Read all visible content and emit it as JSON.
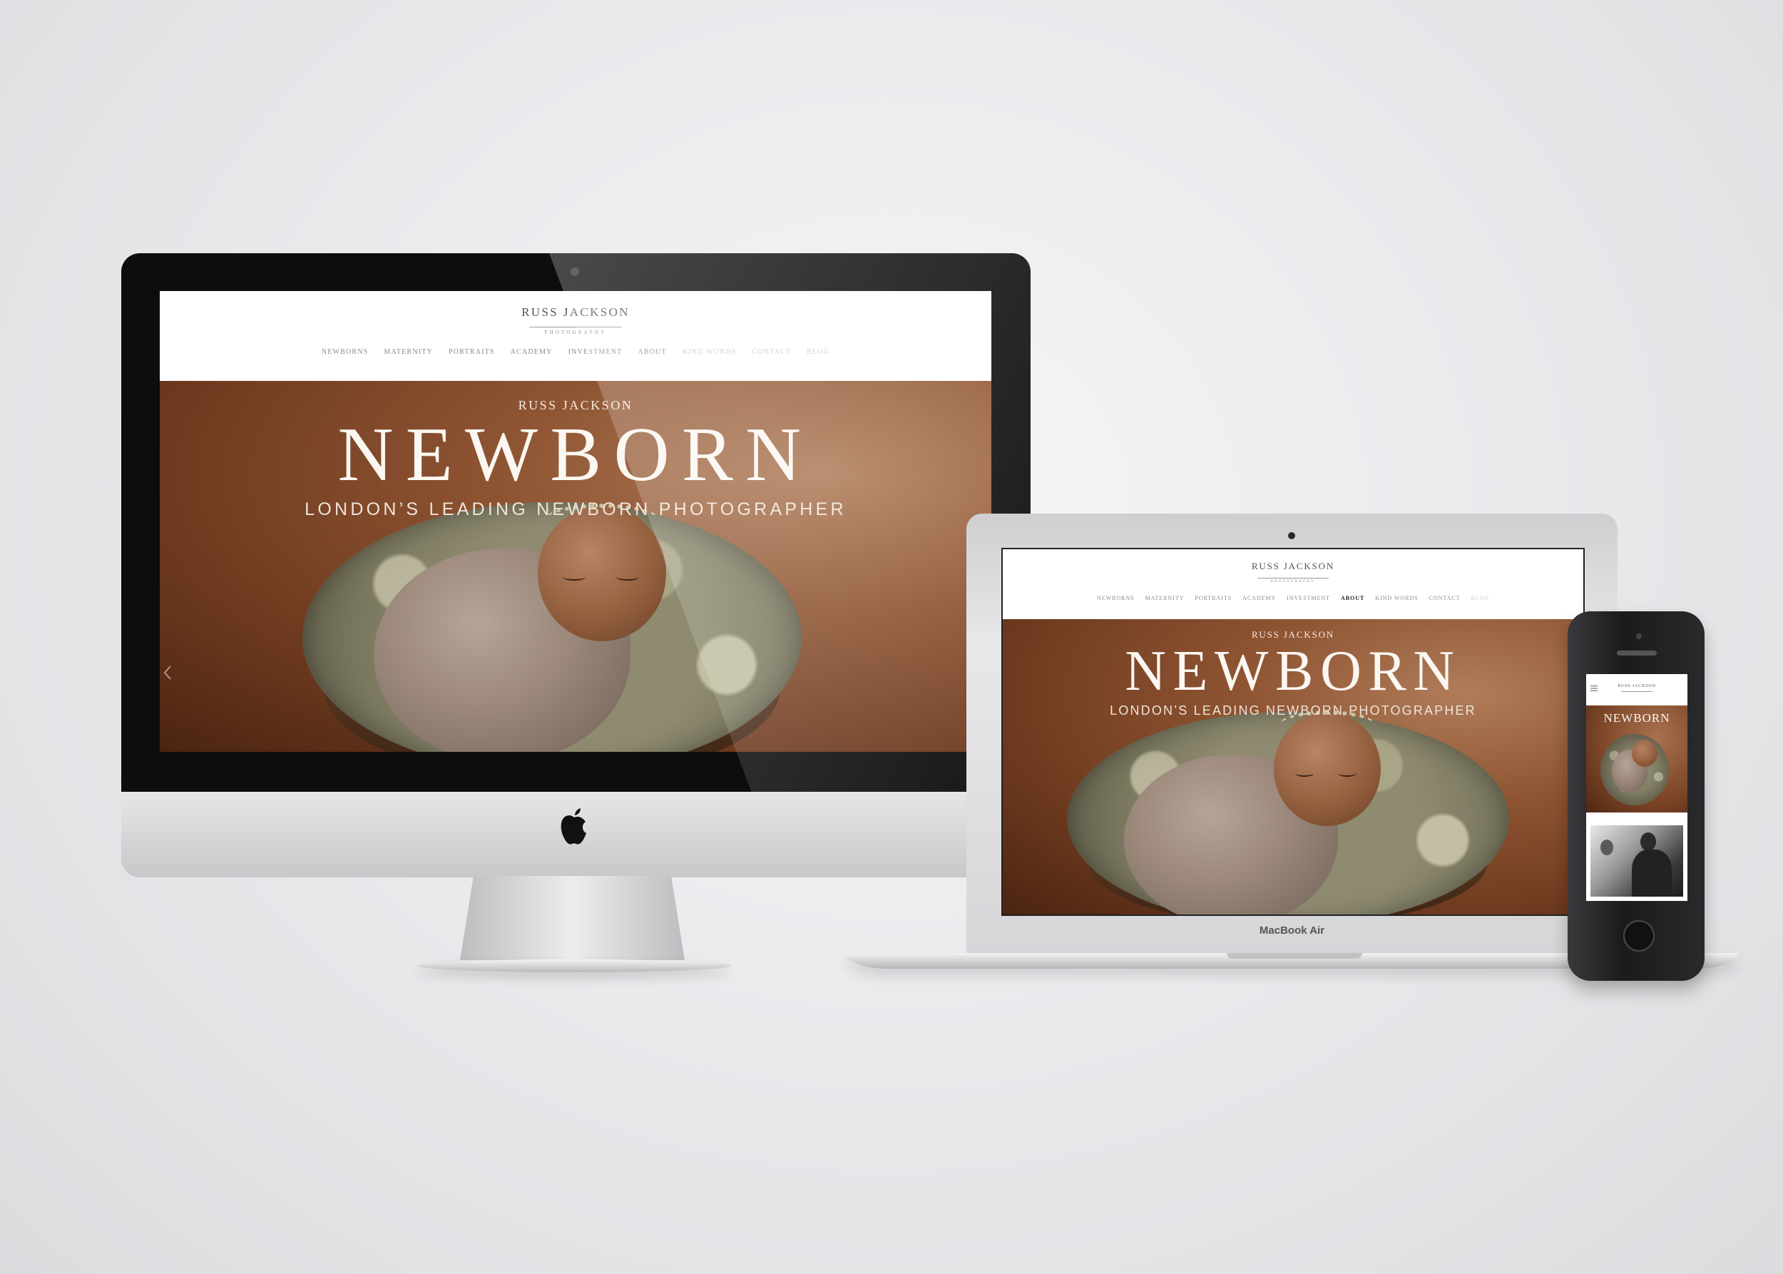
{
  "site": {
    "brand": "RUSS JACKSON",
    "brand_sub": "PHOTOGRAPHY",
    "nav": [
      "NEWBORNS",
      "MATERNITY",
      "PORTRAITS",
      "ACADEMY",
      "INVESTMENT",
      "ABOUT",
      "KIND WORDS",
      "CONTACT",
      "BLOG"
    ],
    "active_nav": "ABOUT",
    "hero_brand": "RUSS JACKSON",
    "hero_title": "NEWBORN",
    "hero_subtitle": "LONDON’S LEADING NEWBORN PHOTOGRAPHER"
  },
  "devices": {
    "laptop_label": "MacBook Air"
  },
  "icons": {
    "desktop_logo": "apple-logo-icon",
    "slider_prev": "chevron-left-icon",
    "mobile_menu": "hamburger-menu-icon"
  },
  "colors": {
    "hero_brown": "#8e5432",
    "background": "#ebebee",
    "nav_text": "#8a8a8a"
  }
}
